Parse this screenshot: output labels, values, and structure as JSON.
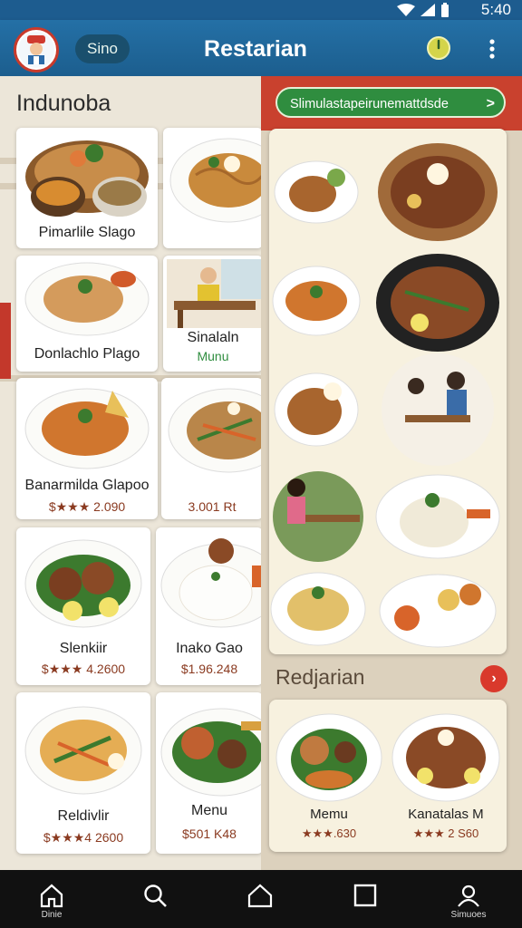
{
  "status_bar": {
    "time": "5:40"
  },
  "app_bar": {
    "chip_label": "Sino",
    "title": "Restarian"
  },
  "left": {
    "section_title": "Indunoba",
    "cards": [
      {
        "name": "Pimarlile Slago",
        "price": ""
      },
      {
        "name": "",
        "price": ""
      },
      {
        "name": "Donlachlo Plago",
        "price": ""
      },
      {
        "name": "Sinalaln",
        "price": "Munu"
      },
      {
        "name": "Banarmilda Glapoo",
        "price": "$★★★ 2.090"
      },
      {
        "name": "",
        "price": "3.001 Rt"
      },
      {
        "name": "Slenkiir",
        "price": "$★★★ 4.2600"
      },
      {
        "name": "Inako Gao",
        "price": "$1.96.248"
      },
      {
        "name": "Reldivlir",
        "price": "$★★★4 2600"
      },
      {
        "name": "Menu",
        "price": "$501 K48"
      }
    ]
  },
  "right": {
    "promo_label": "Slimulastapeirunemattdsde",
    "promo_arrow": ">",
    "subheader": "Redjarian",
    "sub_arrow": "›",
    "bottom_cards": [
      {
        "name": "Memu",
        "price": "★★★.630"
      },
      {
        "name": "Kanatalas M",
        "price": "★★★ 2 S60"
      }
    ]
  },
  "nav": {
    "home_label": "Dinie",
    "profile_label": "Simuoes"
  },
  "colors": {
    "appbar": "#1f66a0",
    "promo_banner": "#c9412e",
    "promo_pill": "#2f8d3f",
    "price": "#8a3a20"
  }
}
